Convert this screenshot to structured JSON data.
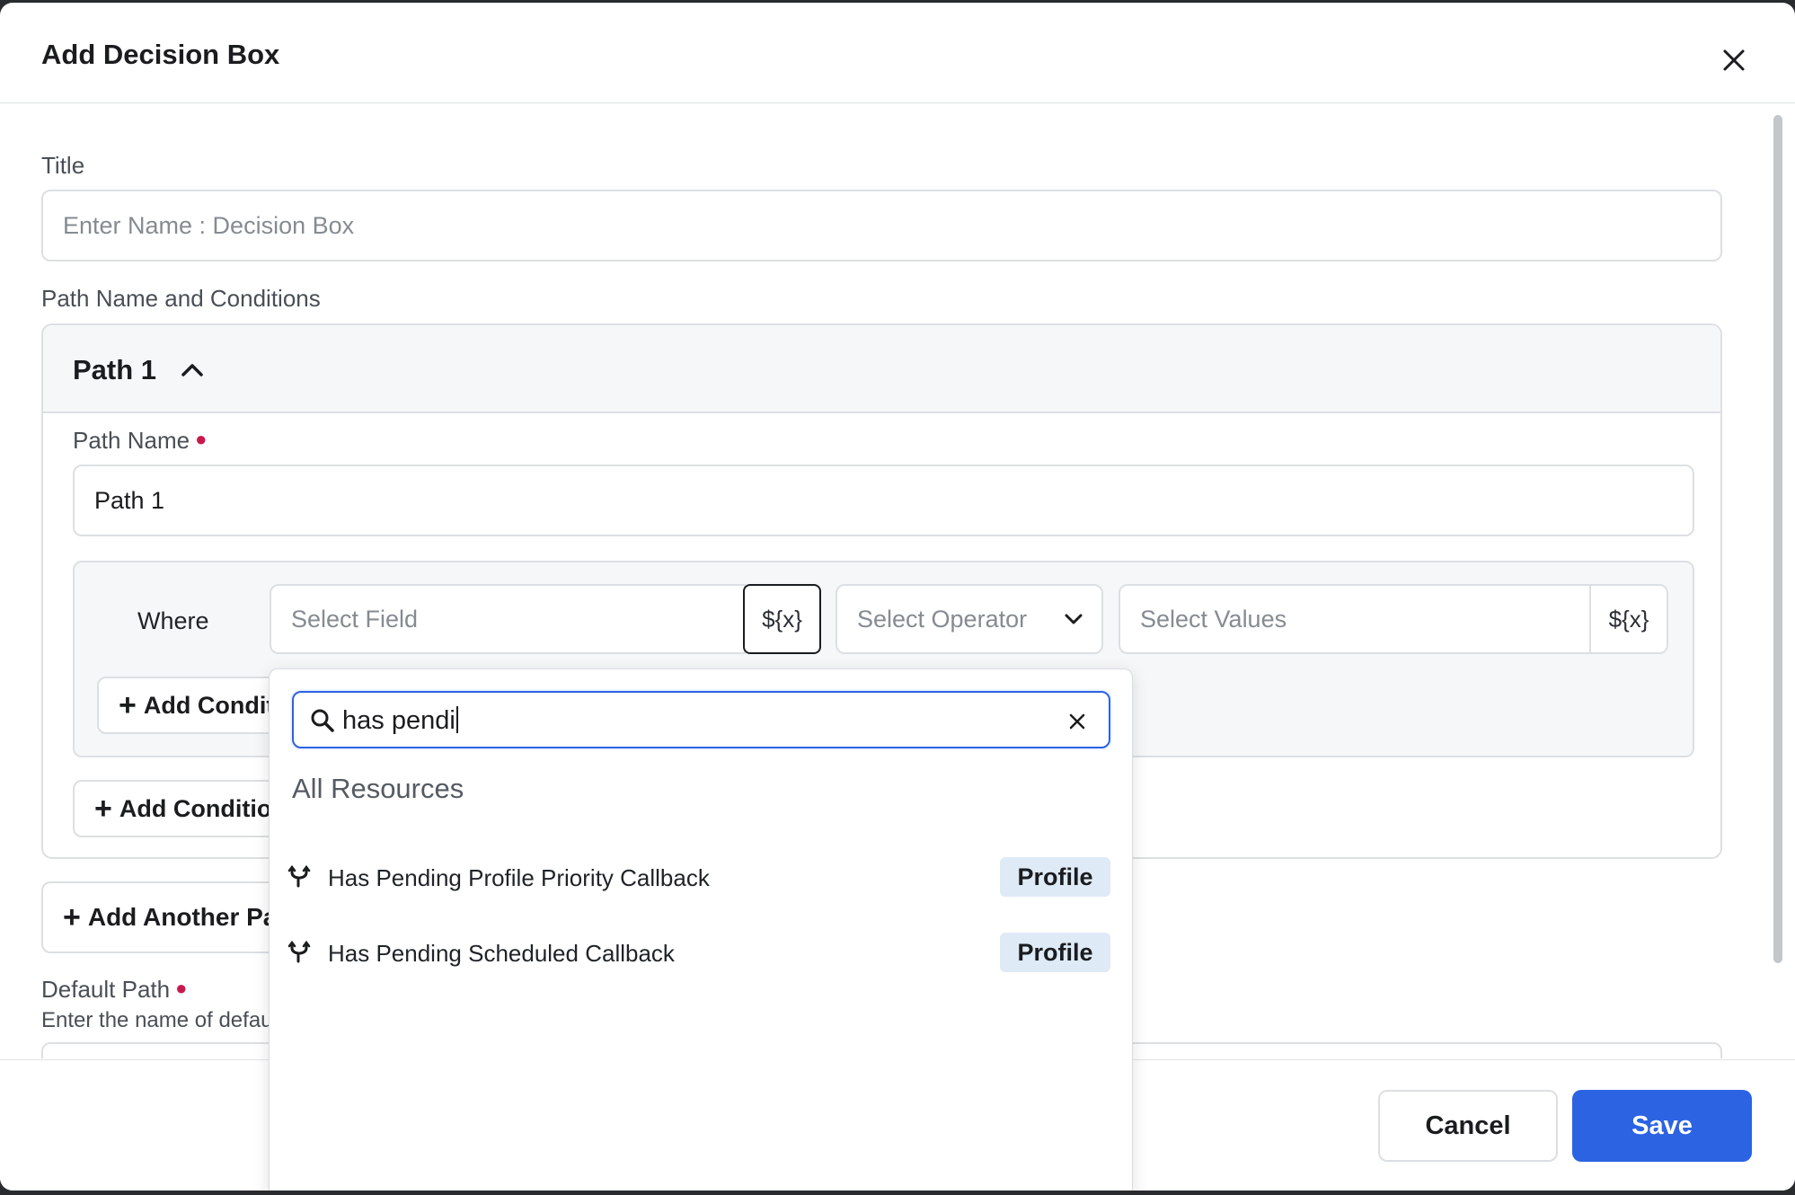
{
  "modal": {
    "title": "Add Decision Box"
  },
  "form": {
    "title_label": "Title",
    "title_placeholder": "Enter Name : Decision Box",
    "path_section_label": "Path Name and Conditions",
    "path": {
      "header": "Path 1",
      "name_label": "Path Name",
      "name_value": "Path 1",
      "where_label": "Where",
      "field_placeholder": "Select Field",
      "variable_button": "${x}",
      "operator_placeholder": "Select Operator",
      "values_placeholder": "Select Values",
      "values_variable_button": "${x}",
      "add_condition_inner": "Add Condition",
      "add_condition_outer": "Add Condition Group"
    },
    "add_another_path": "Add Another Path",
    "default_path_label": "Default Path",
    "default_path_help": "Enter the name of default path"
  },
  "dropdown": {
    "search_value": "has pendi",
    "section_title": "All Resources",
    "items": [
      {
        "label": "Has Pending Profile Priority Callback",
        "badge": "Profile",
        "icon": "branch-icon"
      },
      {
        "label": "Has Pending Scheduled Callback",
        "badge": "Profile",
        "icon": "branch-icon"
      }
    ]
  },
  "footer": {
    "cancel_label": "Cancel",
    "save_label": "Save"
  },
  "colors": {
    "primary": "#2b63e3",
    "required": "#c8194f",
    "badge_bg": "#deeaf5"
  }
}
